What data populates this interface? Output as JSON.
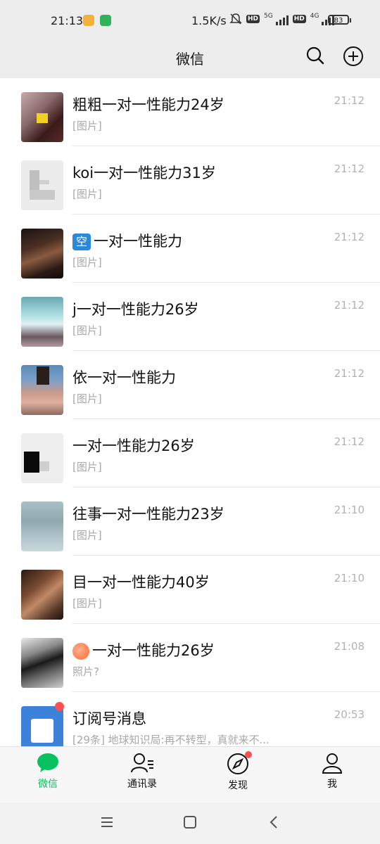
{
  "status_bar": {
    "time": "21:13",
    "net_speed": "1.5K/s",
    "hd1": "HD",
    "gen1": "5G",
    "hd2": "HD",
    "gen2": "4G",
    "battery": "83"
  },
  "header": {
    "title": "微信",
    "search_icon": "search-icon",
    "add_icon": "plus-circle-icon"
  },
  "chats": [
    {
      "name": "粗粗一对一性能力24岁",
      "preview": "[图片]",
      "time": "21:12"
    },
    {
      "name": "koi一对一性能力31岁",
      "preview": "[图片]",
      "time": "21:12"
    },
    {
      "name": "一对一性能力",
      "emoji_text": "空",
      "preview": "[图片]",
      "time": "21:12"
    },
    {
      "name": "j一对一性能力26岁",
      "preview": "[图片]",
      "time": "21:12"
    },
    {
      "name": "依一对一性能力",
      "preview": "[图片]",
      "time": "21:12"
    },
    {
      "name": "一对一性能力26岁",
      "preview": "[图片]",
      "time": "21:12"
    },
    {
      "name": "往事一对一性能力23岁",
      "preview": "[图片]",
      "time": "21:10"
    },
    {
      "name": "目一对一性能力40岁",
      "preview": "[图片]",
      "time": "21:10"
    },
    {
      "name": "一对一性能力26岁",
      "emoji": "peach",
      "preview": "照片?",
      "time": "21:08"
    },
    {
      "name": "订阅号消息",
      "preview": "[29条] 地球知识局:再不转型，真就来不...",
      "time": "20:53"
    }
  ],
  "tabs": [
    {
      "label": "微信",
      "icon": "chat-bubble-icon"
    },
    {
      "label": "通讯录",
      "icon": "contacts-icon"
    },
    {
      "label": "发现",
      "icon": "compass-icon"
    },
    {
      "label": "我",
      "icon": "person-icon"
    }
  ],
  "colors": {
    "accent": "#07c160",
    "badge": "#fa5151"
  }
}
